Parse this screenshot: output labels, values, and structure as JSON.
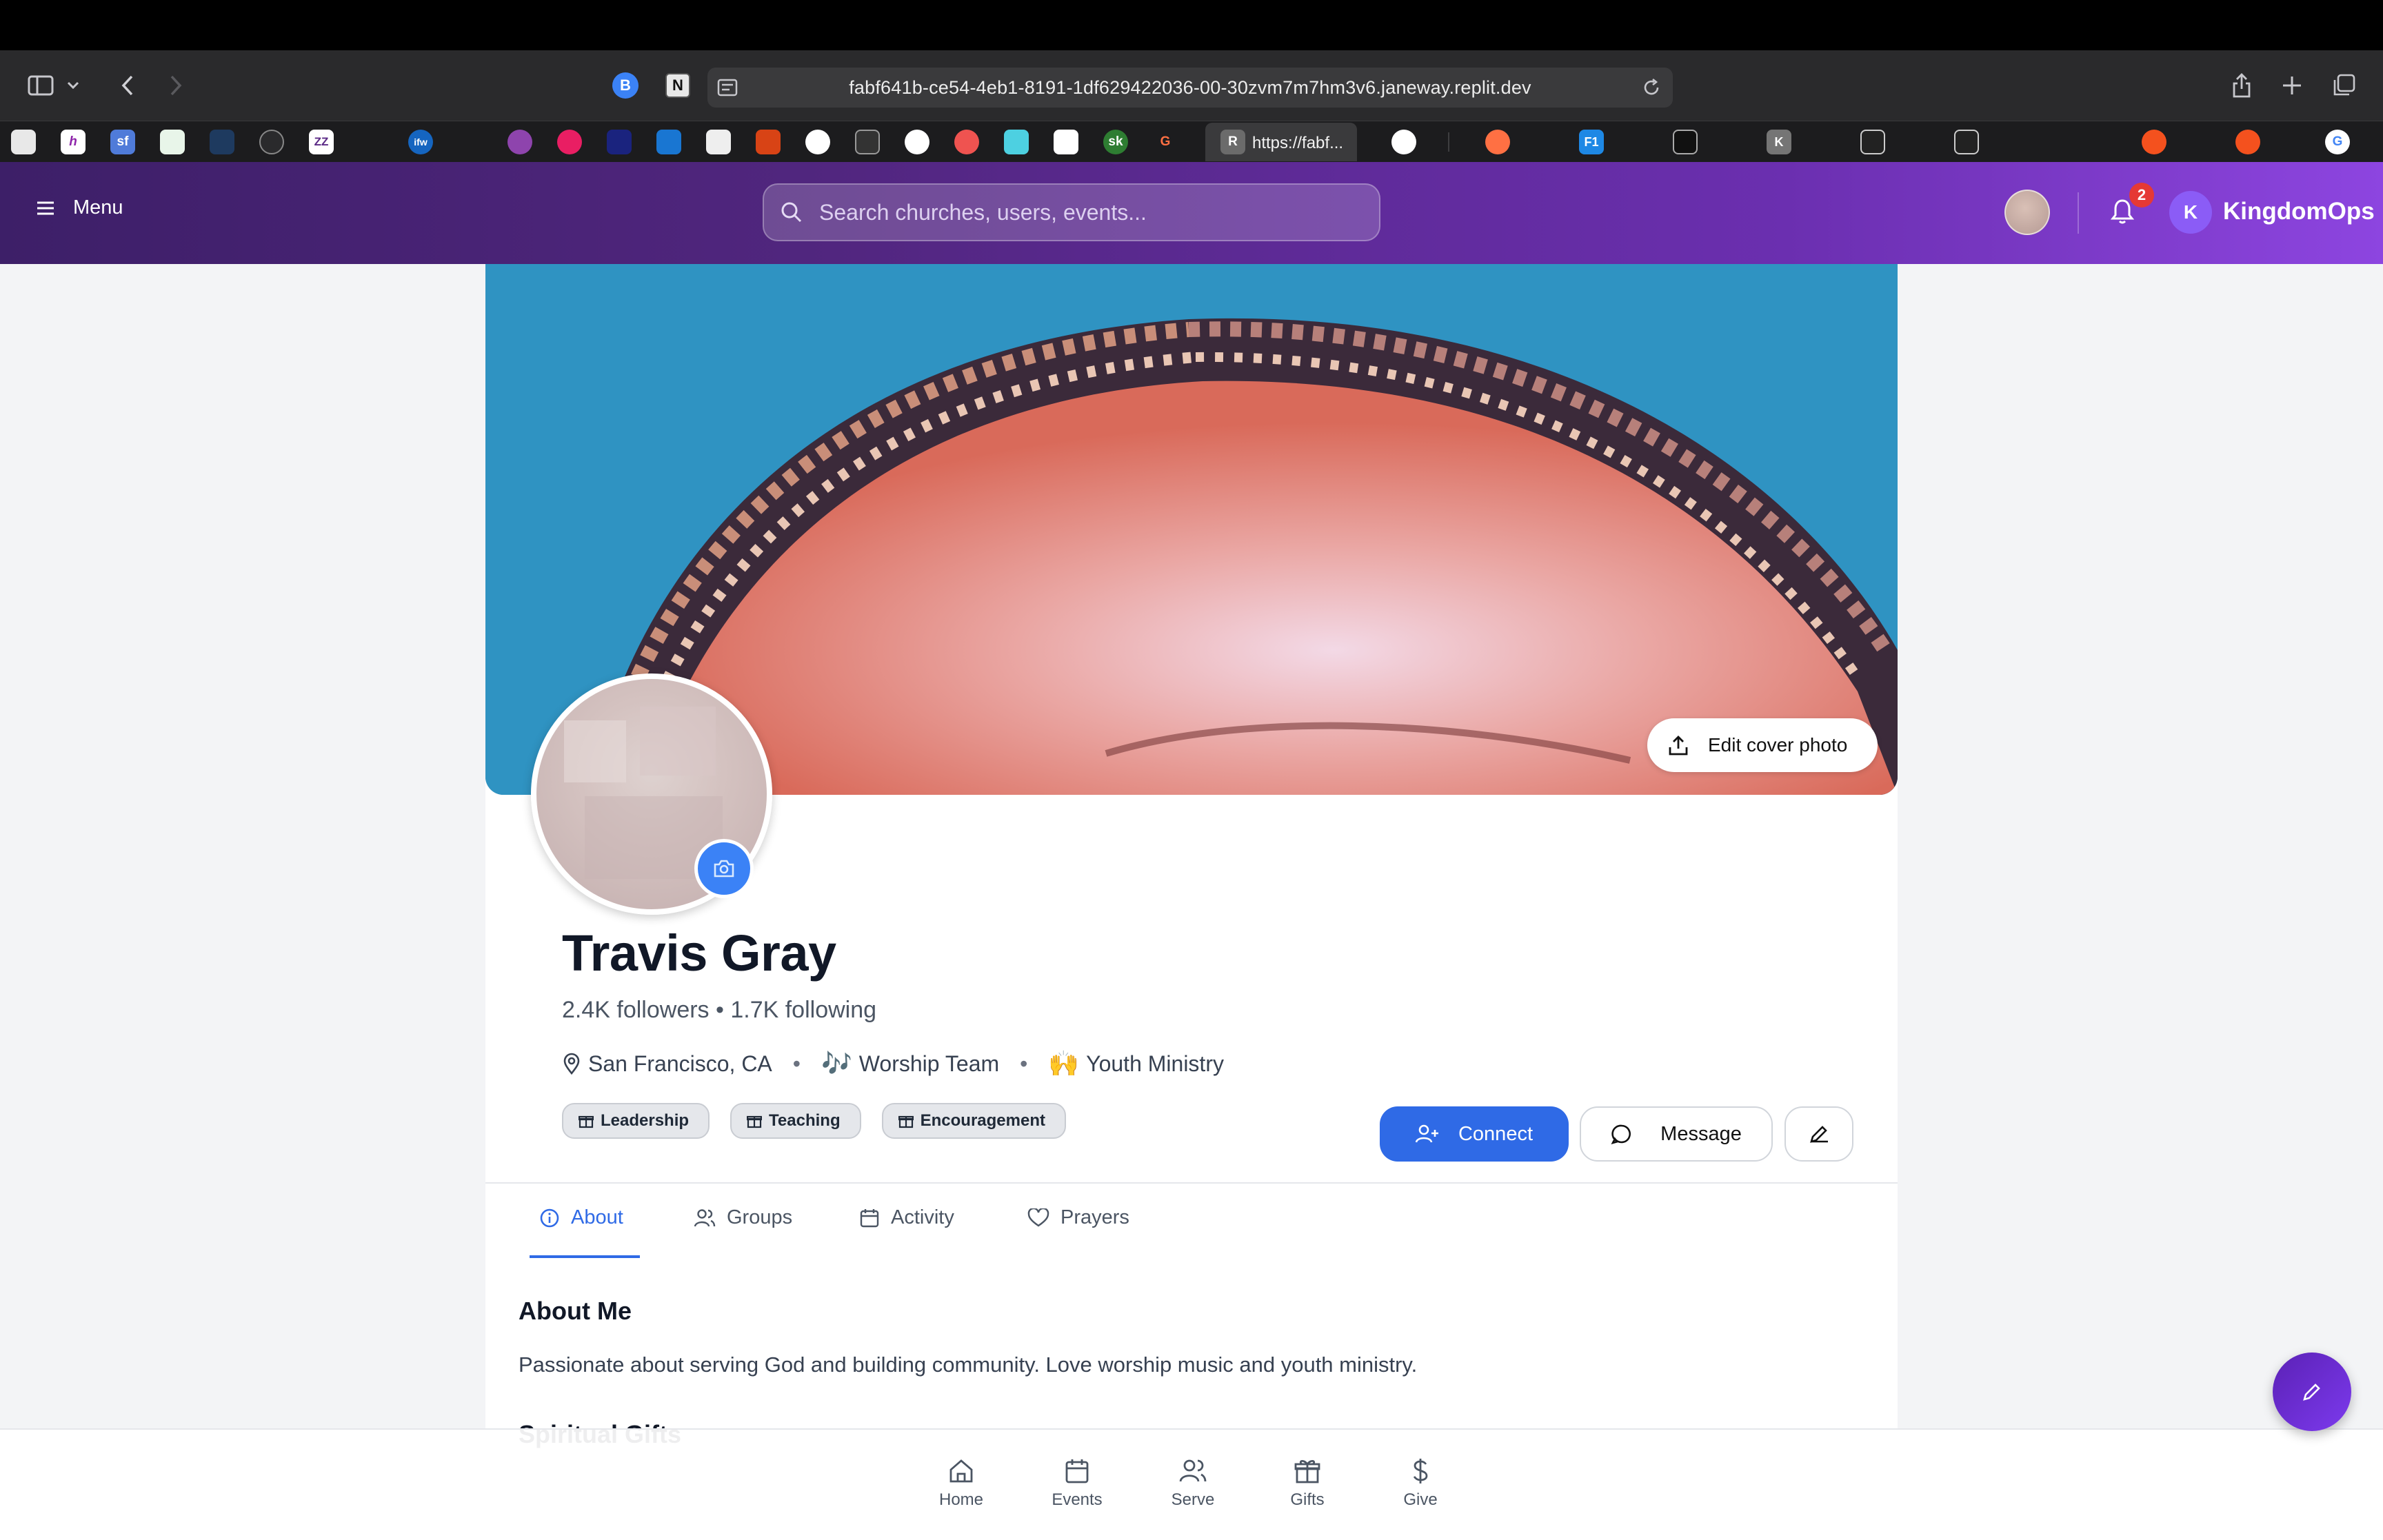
{
  "browser": {
    "url": "fabf641b-ce54-4eb1-8191-1df629422036-00-30zvm7m7hm3v6.janeway.replit.dev",
    "active_tab_label": "https://fabf...",
    "active_tab_favicon": "R",
    "favicons": [
      "",
      "h",
      "sf",
      "",
      "",
      "",
      "ZZ",
      "",
      "ifw",
      "",
      "",
      "",
      "",
      "",
      "",
      "",
      "",
      "",
      "",
      "",
      "",
      "",
      "sk",
      "G",
      ""
    ]
  },
  "header": {
    "menu_label": "Menu",
    "search_placeholder": "Search churches, users, events...",
    "notification_count": "2",
    "brand_initial": "K",
    "brand_name": "KingdomOps"
  },
  "cover": {
    "edit_label": "Edit cover photo"
  },
  "profile": {
    "name": "Travis Gray",
    "stats": "2.4K followers • 1.7K following",
    "location": "San Francisco, CA",
    "team_emoji": "🎶",
    "team": "Worship Team",
    "ministry_emoji": "🙌",
    "ministry": "Youth Ministry",
    "gifts": [
      "Leadership",
      "Teaching",
      "Encouragement"
    ]
  },
  "actions": {
    "connect": "Connect",
    "message": "Message"
  },
  "tabs": [
    {
      "label": "About",
      "icon": "info-icon",
      "active": true
    },
    {
      "label": "Groups",
      "icon": "users-icon",
      "active": false
    },
    {
      "label": "Activity",
      "icon": "calendar-icon",
      "active": false
    },
    {
      "label": "Prayers",
      "icon": "heart-icon",
      "active": false
    }
  ],
  "about": {
    "title": "About Me",
    "text": "Passionate about serving God and building community. Love worship music and youth ministry.",
    "spiritual_gifts_title": "Spiritual Gifts"
  },
  "bottom_nav": [
    {
      "label": "Home",
      "icon": "home-icon"
    },
    {
      "label": "Events",
      "icon": "calendar-icon"
    },
    {
      "label": "Serve",
      "icon": "users-icon"
    },
    {
      "label": "Gifts",
      "icon": "gift-icon"
    },
    {
      "label": "Give",
      "icon": "dollar-icon"
    }
  ],
  "colors": {
    "header_start": "#3d1f68",
    "header_end": "#8d45e0",
    "accent_blue": "#2f6ae6",
    "badge_red": "#e53935"
  }
}
